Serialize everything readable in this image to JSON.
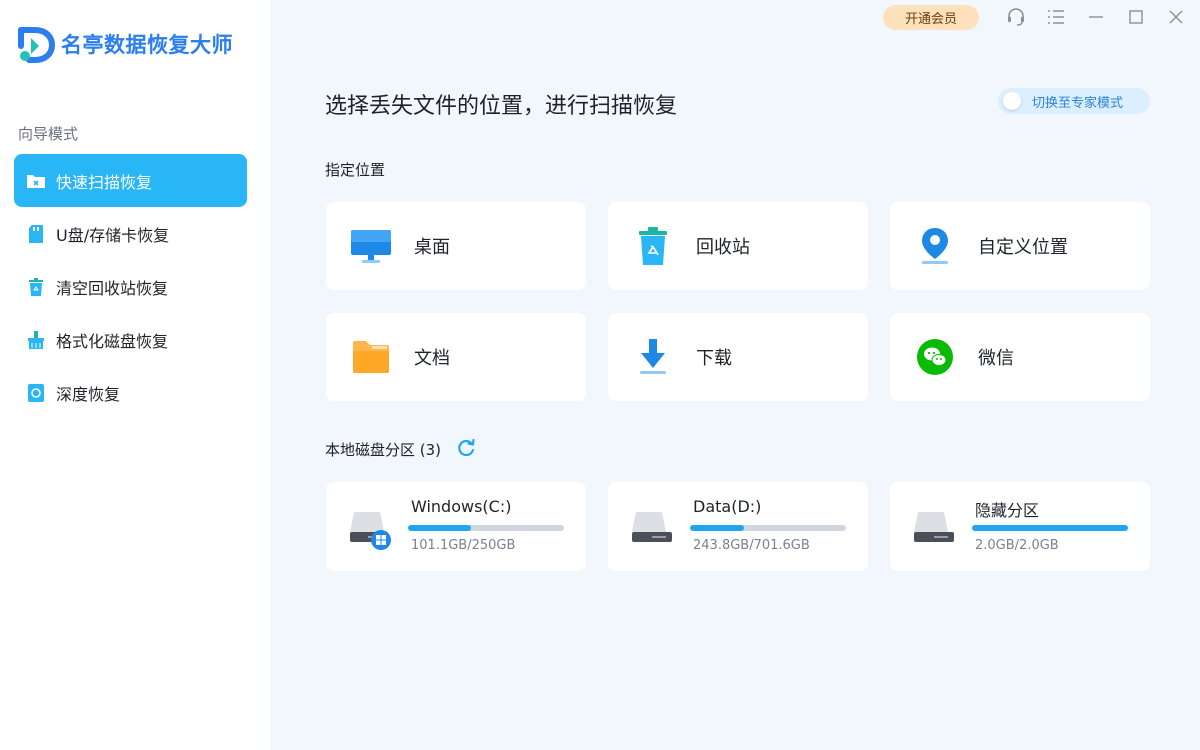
{
  "app": {
    "name": "名亭数据恢复大师",
    "brand_color": "#2a7ef0",
    "accent_color": "#29b6f6"
  },
  "sidebar": {
    "section_label": "向导模式",
    "items": [
      {
        "label": "快速扫描恢复",
        "icon": "folder-scan-icon",
        "active": true
      },
      {
        "label": "U盘/存储卡恢复",
        "icon": "sd-card-icon",
        "active": false
      },
      {
        "label": "清空回收站恢复",
        "icon": "recycle-bin-icon",
        "active": false
      },
      {
        "label": "格式化磁盘恢复",
        "icon": "format-disk-icon",
        "active": false
      },
      {
        "label": "深度恢复",
        "icon": "deep-recovery-icon",
        "active": false
      }
    ]
  },
  "topbar": {
    "vip_label": "开通会员",
    "icons": [
      "headset-icon",
      "menu-icon",
      "minimize-icon",
      "maximize-icon",
      "close-icon"
    ]
  },
  "main": {
    "title": "选择丢失文件的位置，进行扫描恢复",
    "expert_mode_label": "切换至专家模式",
    "locations_title": "指定位置",
    "locations": [
      {
        "label": "桌面",
        "icon": "desktop-monitor-icon"
      },
      {
        "label": "回收站",
        "icon": "recycle-bin-icon"
      },
      {
        "label": "自定义位置",
        "icon": "location-pin-icon"
      },
      {
        "label": "文档",
        "icon": "document-folder-icon"
      },
      {
        "label": "下载",
        "icon": "download-arrow-icon"
      },
      {
        "label": "微信",
        "icon": "wechat-icon"
      }
    ],
    "disks_title": "本地磁盘分区 (3)",
    "disks": [
      {
        "name": "Windows(C:)",
        "usage": "101.1GB/250GB",
        "used_fraction": 0.404,
        "icon": "windows-drive-icon"
      },
      {
        "name": "Data(D:)",
        "usage": "243.8GB/701.6GB",
        "used_fraction": 0.347,
        "icon": "hard-drive-icon"
      },
      {
        "name": "隐藏分区",
        "usage": "2.0GB/2.0GB",
        "used_fraction": 1.0,
        "icon": "hard-drive-icon"
      }
    ]
  }
}
